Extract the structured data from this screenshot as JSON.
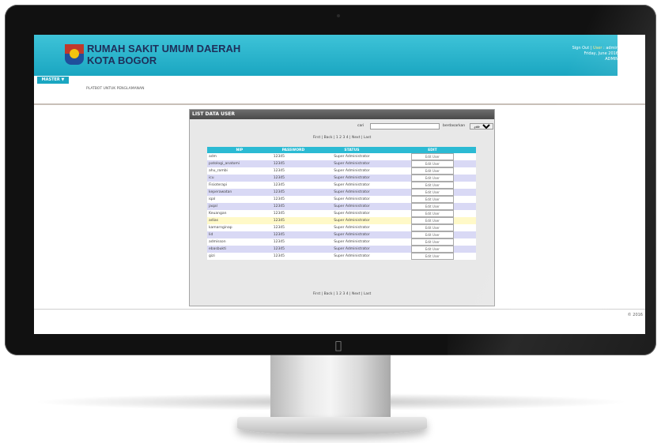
{
  "app": {
    "hospital_name": "RUMAH SAKIT UMUM DAERAH",
    "hospital_city": "KOTA BOGOR"
  },
  "user": {
    "line1_prefix": "Sign Out",
    "line1_link": "User",
    "line1_suffix": "admin",
    "line2": "Friday, June 2016",
    "line3": "ADMIN"
  },
  "menu": {
    "master_label": "MASTER ▼",
    "breadcrumb": "PLATBOT UNTUK PENGLAMANAN"
  },
  "panel": {
    "title": "LIST DATA USER",
    "search_label": "cari",
    "search_placeholder": "",
    "filter_label": "berdasarkan",
    "filter_selected": "-pilih-"
  },
  "pager": {
    "text": "First | Back | 1 2 3 4 | Next | Last"
  },
  "table": {
    "headers": [
      "NIP",
      "PASSWORD",
      "STATUS",
      "EDIT"
    ],
    "rows": [
      {
        "nip": "adm",
        "password": "12345",
        "status": "Super Administrator",
        "edit": "Edit User"
      },
      {
        "nip": "patologi_anatomi",
        "password": "12345",
        "status": "Super Administrator",
        "edit": "Edit User"
      },
      {
        "nip": "ahu_rambi",
        "password": "12345",
        "status": "Super Administrator",
        "edit": "Edit User"
      },
      {
        "nip": "icu",
        "password": "12345",
        "status": "Super Administrator",
        "edit": "Edit User"
      },
      {
        "nip": "Fisioterapi",
        "password": "12345",
        "status": "Super Administrator",
        "edit": "Edit User"
      },
      {
        "nip": "keperawatan",
        "password": "12345",
        "status": "Super Administrator",
        "edit": "Edit User"
      },
      {
        "nip": "iqal",
        "password": "12345",
        "status": "Super Administrator",
        "edit": "Edit User"
      },
      {
        "nip": "jaqal",
        "password": "12345",
        "status": "Super Administrator",
        "edit": "Edit User"
      },
      {
        "nip": "Keuangan",
        "password": "12345",
        "status": "Super Administrator",
        "edit": "Edit User"
      },
      {
        "nip": "adias",
        "password": "12345",
        "status": "Super Administrator",
        "edit": "Edit User"
      },
      {
        "nip": "kamarnginap",
        "password": "12345",
        "status": "Super Administrator",
        "edit": "Edit User"
      },
      {
        "nip": "lid",
        "password": "12345",
        "status": "Super Administrator",
        "edit": "Edit User"
      },
      {
        "nip": "admisson",
        "password": "12345",
        "status": "Super Administrator",
        "edit": "Edit User"
      },
      {
        "nip": "ebasbukti",
        "password": "12345",
        "status": "Super Administrator",
        "edit": "Edit User"
      },
      {
        "nip": "gizi",
        "password": "12345",
        "status": "Super Administrator",
        "edit": "Edit User"
      }
    ]
  },
  "footer": {
    "copyright": "© 2016"
  },
  "colors": {
    "header_teal": "#1aa6c1",
    "table_header": "#2bbad3",
    "row_alt": "#d9d9f5",
    "row_highlight": "#fff9c8"
  },
  "icons": {
    "apple": "apple-logo-icon",
    "logo": "hospital-logo-icon"
  }
}
